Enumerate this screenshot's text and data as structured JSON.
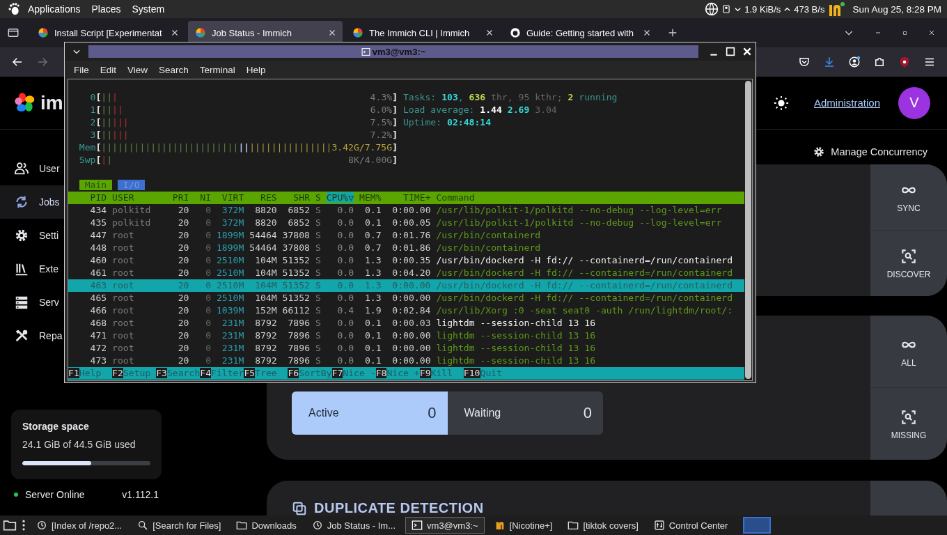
{
  "desktop_panel": {
    "menus": [
      "Applications",
      "Places",
      "System"
    ],
    "download_speed": "1.9 KiB/s",
    "upload_speed": "473 B/s",
    "clock": "Sun Aug 25, 8:28 PM"
  },
  "browser": {
    "tabs": [
      {
        "title": "Install Script [Experimentat",
        "selected": false
      },
      {
        "title": "Job Status - Immich",
        "selected": true
      },
      {
        "title": "The Immich CLI | Immich",
        "selected": false
      },
      {
        "title": "Guide: Getting started with",
        "selected": false
      }
    ]
  },
  "page": {
    "logo_text": "im",
    "admin_link": "Administration",
    "avatar_initial": "V",
    "sidebar": {
      "items": [
        {
          "label": "User",
          "selected": false
        },
        {
          "label": "Jobs",
          "selected": true
        },
        {
          "label": "Setti",
          "selected": false
        },
        {
          "label": "Exte",
          "selected": false
        },
        {
          "label": "Serv",
          "selected": false
        },
        {
          "label": "Repa",
          "selected": false
        }
      ]
    },
    "storage": {
      "title": "Storage space",
      "usage": "24.1 GiB of 44.5 GiB used",
      "level": 0.54
    },
    "server": {
      "status": "Server Online",
      "online": true,
      "version": "v1.112.1"
    },
    "concurrency_button": "Manage Concurrency",
    "job_cards": [
      {
        "actions": [
          {
            "label": "SYNC",
            "kind": "infinity"
          },
          {
            "label": "DISCOVER",
            "kind": "scan"
          }
        ]
      },
      {
        "counts": [
          {
            "label": "Active",
            "value": "0",
            "kind": "active"
          },
          {
            "label": "Waiting",
            "value": "0",
            "kind": "waiting"
          }
        ],
        "actions": [
          {
            "label": "ALL",
            "kind": "infinity"
          },
          {
            "label": "MISSING",
            "kind": "scan"
          }
        ]
      },
      {
        "title": "DUPLICATE DETECTION"
      }
    ]
  },
  "terminal": {
    "title": "vm3@vm3:~",
    "menu": [
      "File",
      "Edit",
      "View",
      "Search",
      "Terminal",
      "Help"
    ],
    "htop": {
      "cpus": [
        {
          "label": "0",
          "segments": [
            {
              "kind": "normal",
              "text": "||"
            },
            {
              "kind": "kernel",
              "text": "|"
            }
          ],
          "value": "4.3%",
          "open": "[",
          "close": "]"
        },
        {
          "label": "1",
          "segments": [
            {
              "kind": "normal",
              "text": "||"
            },
            {
              "kind": "kernel",
              "text": "||"
            }
          ],
          "value": "6.0%",
          "open": "[",
          "close": "]"
        },
        {
          "label": "2",
          "segments": [
            {
              "kind": "normal",
              "text": "||"
            },
            {
              "kind": "kernel",
              "text": "|||"
            }
          ],
          "value": "7.5%",
          "open": "[",
          "close": "]"
        },
        {
          "label": "3",
          "segments": [
            {
              "kind": "normal",
              "text": "||"
            },
            {
              "kind": "kernel",
              "text": "|||"
            }
          ],
          "value": "7.2%",
          "open": "[",
          "close": "]"
        }
      ],
      "memory": {
        "label": "Mem",
        "segments": [
          {
            "kind": "normal",
            "text": "|||||||||||||||||||||||||"
          },
          {
            "kind": "buffers",
            "text": "||"
          },
          {
            "kind": "cache",
            "text": "|||||||||||||||"
          }
        ],
        "value": "3.42G/7.75G",
        "open": "[",
        "close": "]"
      },
      "swap": {
        "label": "Swp",
        "segments": [
          {
            "kind": "kernel",
            "text": "|"
          },
          {
            "kind": "normal",
            "text": "|"
          }
        ],
        "value": "8K/4.00G",
        "open": "[",
        "close": "]"
      },
      "summary": [
        [
          {
            "text": "Tasks: ",
            "kind": "label"
          },
          {
            "text": "103",
            "kind": "value"
          },
          {
            "text": ", ",
            "kind": "label"
          },
          {
            "text": "636",
            "kind": "accent"
          },
          {
            "text": " thr, 95 kthr; ",
            "kind": "muted"
          },
          {
            "text": "2",
            "kind": "accent"
          },
          {
            "text": " running",
            "kind": "label"
          }
        ],
        [
          {
            "text": "Load average: ",
            "kind": "label"
          },
          {
            "text": "1.44 ",
            "kind": "bright"
          },
          {
            "text": "2.69 ",
            "kind": "value"
          },
          {
            "text": "3.04",
            "kind": "muted"
          }
        ],
        [
          {
            "text": "Uptime: ",
            "kind": "label"
          },
          {
            "text": "02:48:14",
            "kind": "value"
          }
        ]
      ],
      "tabs": [
        {
          "label": "Main",
          "selected": true
        },
        {
          "label": "I/O",
          "selected": false
        }
      ],
      "columns": [
        {
          "label": "PID",
          "selected": false
        },
        {
          "label": "USER",
          "selected": false
        },
        {
          "label": "PRI",
          "selected": false
        },
        {
          "label": "NI",
          "selected": false
        },
        {
          "label": "VIRT",
          "selected": false
        },
        {
          "label": "RES",
          "selected": false
        },
        {
          "label": "SHR",
          "selected": false
        },
        {
          "label": "S",
          "selected": false
        },
        {
          "label": "CPU%▽",
          "selected": true
        },
        {
          "label": "MEM%",
          "selected": false
        },
        {
          "label": "TIME+",
          "selected": false
        },
        {
          "label": "Command",
          "selected": false
        }
      ],
      "processes": [
        {
          "pid": "434",
          "user": "polkitd",
          "pri": "20",
          "ni": "0",
          "virt": "372M",
          "res": "8820",
          "shr": "6852",
          "state": "S",
          "cpu": "0.0",
          "mem": "0.1",
          "time": "0:00.00",
          "command": "/usr/lib/polkit-1/polkitd --no-debug --log-level=err",
          "thread": true,
          "selected": false
        },
        {
          "pid": "435",
          "user": "polkitd",
          "pri": "20",
          "ni": "0",
          "virt": "372M",
          "res": "8820",
          "shr": "6852",
          "state": "S",
          "cpu": "0.0",
          "mem": "0.1",
          "time": "0:00.05",
          "command": "/usr/lib/polkit-1/polkitd --no-debug --log-level=err",
          "thread": true,
          "selected": false
        },
        {
          "pid": "447",
          "user": "root",
          "pri": "20",
          "ni": "0",
          "virt": "1899M",
          "res": "54464",
          "shr": "37808",
          "state": "S",
          "cpu": "0.0",
          "mem": "0.7",
          "time": "0:01.76",
          "command": "/usr/bin/containerd",
          "thread": true,
          "selected": false
        },
        {
          "pid": "448",
          "user": "root",
          "pri": "20",
          "ni": "0",
          "virt": "1899M",
          "res": "54464",
          "shr": "37808",
          "state": "S",
          "cpu": "0.0",
          "mem": "0.7",
          "time": "0:01.86",
          "command": "/usr/bin/containerd",
          "thread": true,
          "selected": false
        },
        {
          "pid": "460",
          "user": "root",
          "pri": "20",
          "ni": "0",
          "virt": "2510M",
          "res": "104M",
          "shr": "51352",
          "state": "S",
          "cpu": "0.0",
          "mem": "1.3",
          "time": "0:00.35",
          "command": "/usr/bin/dockerd -H fd:// --containerd=/run/containerd",
          "thread": false,
          "selected": false
        },
        {
          "pid": "461",
          "user": "root",
          "pri": "20",
          "ni": "0",
          "virt": "2510M",
          "res": "104M",
          "shr": "51352",
          "state": "S",
          "cpu": "0.0",
          "mem": "1.3",
          "time": "0:04.20",
          "command": "/usr/bin/dockerd -H fd:// --containerd=/run/containerd",
          "thread": true,
          "selected": false
        },
        {
          "pid": "463",
          "user": "root",
          "pri": "20",
          "ni": "0",
          "virt": "2510M",
          "res": "104M",
          "shr": "51352",
          "state": "S",
          "cpu": "0.0",
          "mem": "1.3",
          "time": "0:00.00",
          "command": "/usr/bin/dockerd -H fd:// --containerd=/run/containerd",
          "thread": true,
          "selected": true
        },
        {
          "pid": "465",
          "user": "root",
          "pri": "20",
          "ni": "0",
          "virt": "2510M",
          "res": "104M",
          "shr": "51352",
          "state": "S",
          "cpu": "0.0",
          "mem": "1.3",
          "time": "0:00.00",
          "command": "/usr/bin/dockerd -H fd:// --containerd=/run/containerd",
          "thread": true,
          "selected": false
        },
        {
          "pid": "466",
          "user": "root",
          "pri": "20",
          "ni": "0",
          "virt": "1039M",
          "res": "152M",
          "shr": "66112",
          "state": "S",
          "cpu": "0.4",
          "mem": "1.9",
          "time": "0:02.84",
          "command": "/usr/lib/Xorg :0 -seat seat0 -auth /run/lightdm/root/:",
          "thread": true,
          "selected": false
        },
        {
          "pid": "468",
          "user": "root",
          "pri": "20",
          "ni": "0",
          "virt": "231M",
          "res": "8792",
          "shr": "7896",
          "state": "S",
          "cpu": "0.0",
          "mem": "0.1",
          "time": "0:00.03",
          "command": "lightdm --session-child 13 16",
          "thread": false,
          "selected": false
        },
        {
          "pid": "471",
          "user": "root",
          "pri": "20",
          "ni": "0",
          "virt": "231M",
          "res": "8792",
          "shr": "7896",
          "state": "S",
          "cpu": "0.0",
          "mem": "0.1",
          "time": "0:00.00",
          "command": "lightdm --session-child 13 16",
          "thread": true,
          "selected": false
        },
        {
          "pid": "472",
          "user": "root",
          "pri": "20",
          "ni": "0",
          "virt": "231M",
          "res": "8792",
          "shr": "7896",
          "state": "S",
          "cpu": "0.0",
          "mem": "0.1",
          "time": "0:00.00",
          "command": "lightdm --session-child 13 16",
          "thread": true,
          "selected": false
        },
        {
          "pid": "473",
          "user": "root",
          "pri": "20",
          "ni": "0",
          "virt": "231M",
          "res": "8792",
          "shr": "7896",
          "state": "S",
          "cpu": "0.0",
          "mem": "0.1",
          "time": "0:00.00",
          "command": "lightdm --session-child 13 16",
          "thread": true,
          "selected": false
        }
      ],
      "function_keys": [
        {
          "key": "F1",
          "label": "Help"
        },
        {
          "key": "F2",
          "label": "Setup"
        },
        {
          "key": "F3",
          "label": "Search"
        },
        {
          "key": "F4",
          "label": "Filter"
        },
        {
          "key": "F5",
          "label": "Tree"
        },
        {
          "key": "F6",
          "label": "SortBy"
        },
        {
          "key": "F7",
          "label": "Nice -"
        },
        {
          "key": "F8",
          "label": "Nice +"
        },
        {
          "key": "F9",
          "label": "Kill"
        },
        {
          "key": "F10",
          "label": "Quit"
        }
      ]
    }
  },
  "taskbar": {
    "items": [
      {
        "label": "[Index of /repo2...",
        "selected": false
      },
      {
        "label": "[Search for Files]",
        "selected": false
      },
      {
        "label": "Downloads",
        "selected": false
      },
      {
        "label": "Job Status - Im...",
        "selected": false
      },
      {
        "label": "vm3@vm3:~",
        "selected": true
      },
      {
        "label": "[Nicotine+]",
        "selected": false
      },
      {
        "label": "[tiktok covers]",
        "selected": false
      },
      {
        "label": "Control Center",
        "selected": false
      }
    ]
  }
}
